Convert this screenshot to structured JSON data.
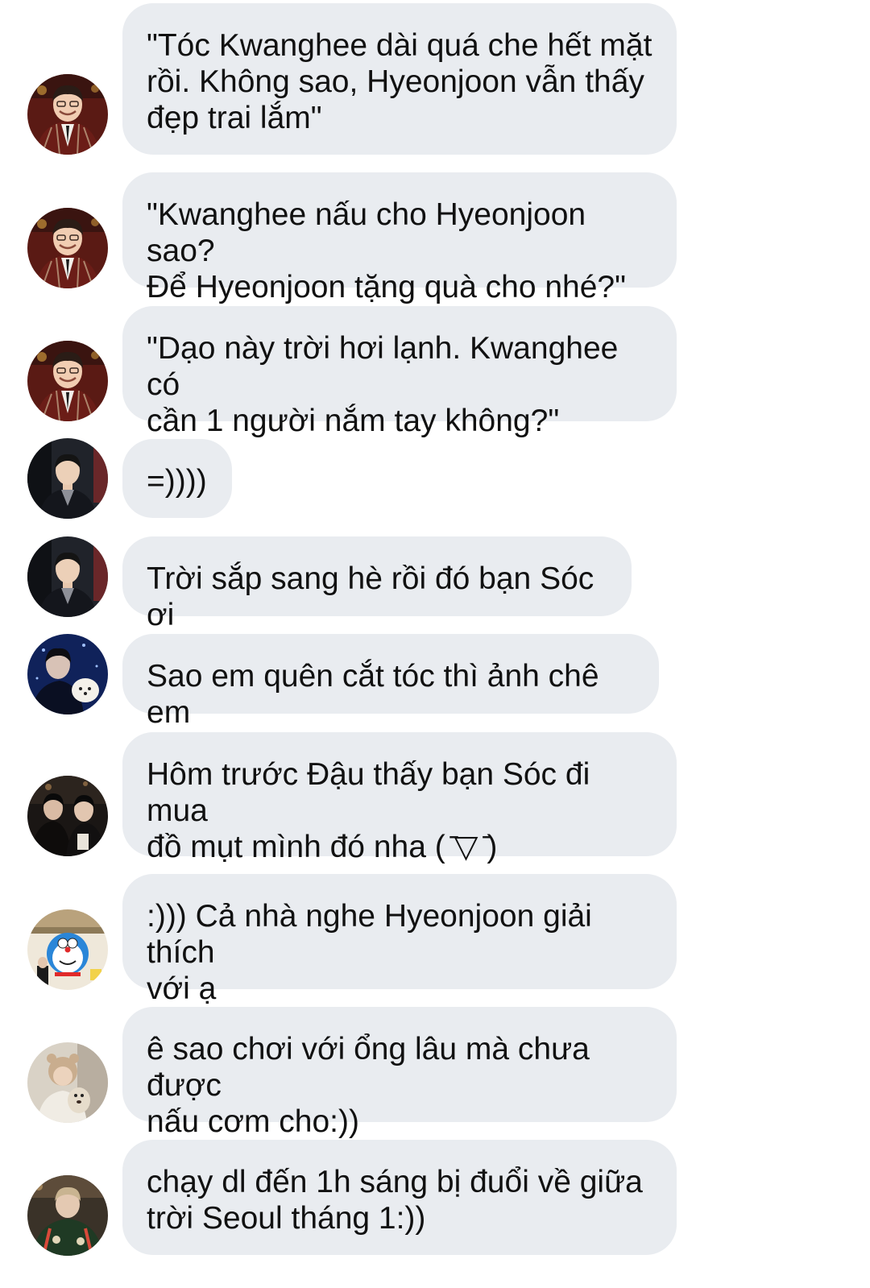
{
  "conversation": {
    "messages": [
      {
        "avatar": "avatar-kwanghee-red-plaid",
        "text": "\"Tóc Kwanghee dài quá che hết mặt\nrồi. Không sao, Hyeonjoon vẫn thấy\nđẹp trai lắm\""
      },
      {
        "avatar": "avatar-kwanghee-red-plaid",
        "text": "\"Kwanghee nấu cho Hyeonjoon sao?\nĐể Hyeonjoon tặng quà cho nhé?\""
      },
      {
        "avatar": "avatar-kwanghee-red-plaid",
        "text": "\"Dạo này trời hơi lạnh. Kwanghee có\ncần 1 người nắm tay không?\""
      },
      {
        "avatar": "avatar-dark-suit",
        "text": "=))))"
      },
      {
        "avatar": "avatar-dark-suit",
        "text": "Trời sắp sang hè rồi đó bạn Sóc ơi"
      },
      {
        "avatar": "avatar-blue-night-dog",
        "text": "Sao em quên cắt tóc thì ảnh chê em"
      },
      {
        "avatar": "avatar-dark-couple",
        "text": "Hôm trước Đậu thấy bạn Sóc đi mua\nđồ mụt mình đó nha ( ̄▽ ̄)"
      },
      {
        "avatar": "avatar-doraemon",
        "text": ":))) Cả nhà nghe Hyeonjoon giải thích\nvới ạ"
      },
      {
        "avatar": "avatar-bear-hat-dog",
        "text": "ê sao chơi với ổng lâu mà chưa được\nnấu cơm cho:))"
      },
      {
        "avatar": "avatar-green-jacket",
        "text": "chạy dl đến 1h sáng bị đuổi về giữa\ntrời Seoul tháng 1:))"
      }
    ]
  },
  "colors": {
    "bubble": "#e9ecf0",
    "text": "#111111",
    "background": "#ffffff"
  }
}
